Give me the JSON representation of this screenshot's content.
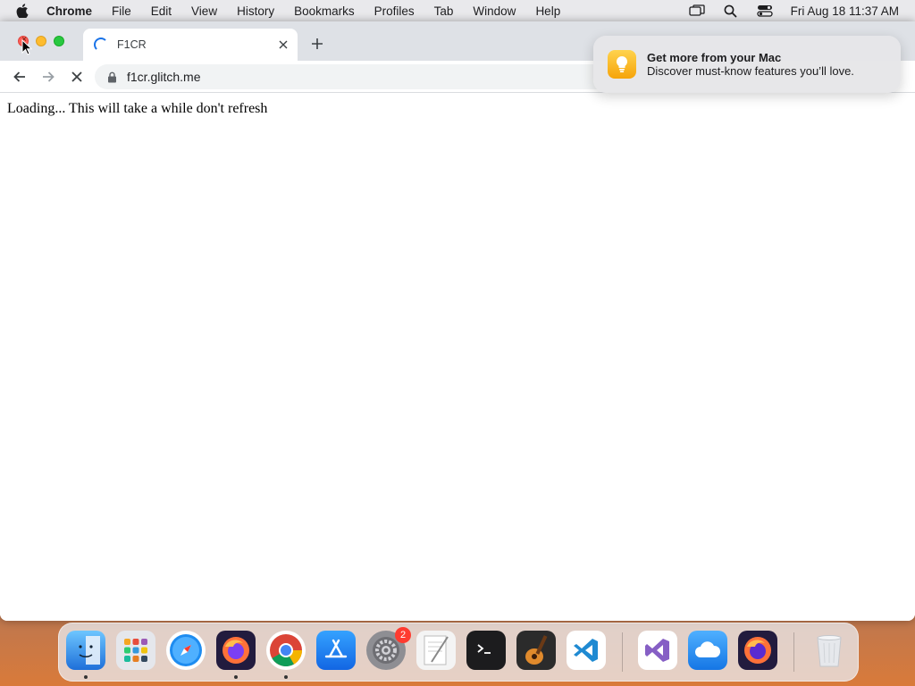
{
  "menubar": {
    "app_name": "Chrome",
    "items": [
      "File",
      "Edit",
      "View",
      "History",
      "Bookmarks",
      "Profiles",
      "Tab",
      "Window",
      "Help"
    ],
    "clock": "Fri Aug 18  11:37 AM",
    "icons": [
      "screen-mirroring-icon",
      "spotlight-search-icon",
      "control-center-icon"
    ]
  },
  "browser": {
    "tab_title": "F1CR",
    "url": "f1cr.glitch.me",
    "loading": true
  },
  "page": {
    "message": "Loading... This will take a while don't refresh"
  },
  "notification": {
    "title": "Get more from your Mac",
    "body": "Discover must-know features you’ll love."
  },
  "dock": {
    "apps": [
      "Finder",
      "Launchpad",
      "Safari",
      "Firefox",
      "Chrome",
      "App Store",
      "System Settings",
      "TextEdit",
      "Terminal",
      "GarageBand",
      "Visual Studio Code",
      "Visual Studio",
      "iCloud",
      "Firefox Nightly",
      "Trash"
    ],
    "system_settings_badge": "2"
  },
  "colors": {
    "accent": "#1a73e8",
    "tabstrip": "#dee1e6"
  }
}
